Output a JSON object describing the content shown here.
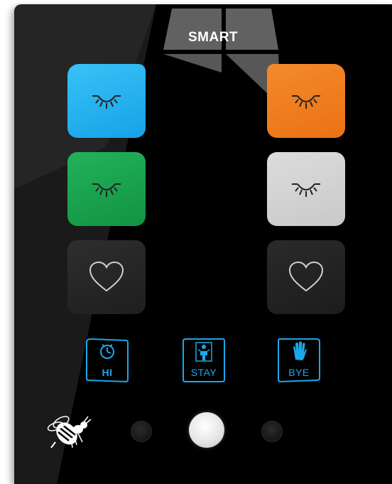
{
  "brand": {
    "label": "SMART"
  },
  "keys": [
    {
      "id": "left-1",
      "icon": "eye-lashes-icon",
      "color": "#25b4f0"
    },
    {
      "id": "left-2",
      "icon": "eye-lashes-icon",
      "color": "#19a84d"
    },
    {
      "id": "left-3",
      "icon": "heart-icon",
      "color": "#2a2a2a"
    },
    {
      "id": "right-1",
      "icon": "eye-lashes-icon",
      "color": "#f07d20"
    },
    {
      "id": "right-2",
      "icon": "eye-lashes-icon",
      "color": "#d4d4d4"
    },
    {
      "id": "right-3",
      "icon": "heart-icon",
      "color": "#2a2a2a"
    }
  ],
  "modes": [
    {
      "label": "HI",
      "icon": "clock-icon"
    },
    {
      "label": "STAY",
      "icon": "person-seated-icon"
    },
    {
      "label": "BYE",
      "icon": "hand-icon"
    }
  ],
  "accent": "#1aa8ec",
  "logo": {
    "icon": "bee-icon"
  }
}
